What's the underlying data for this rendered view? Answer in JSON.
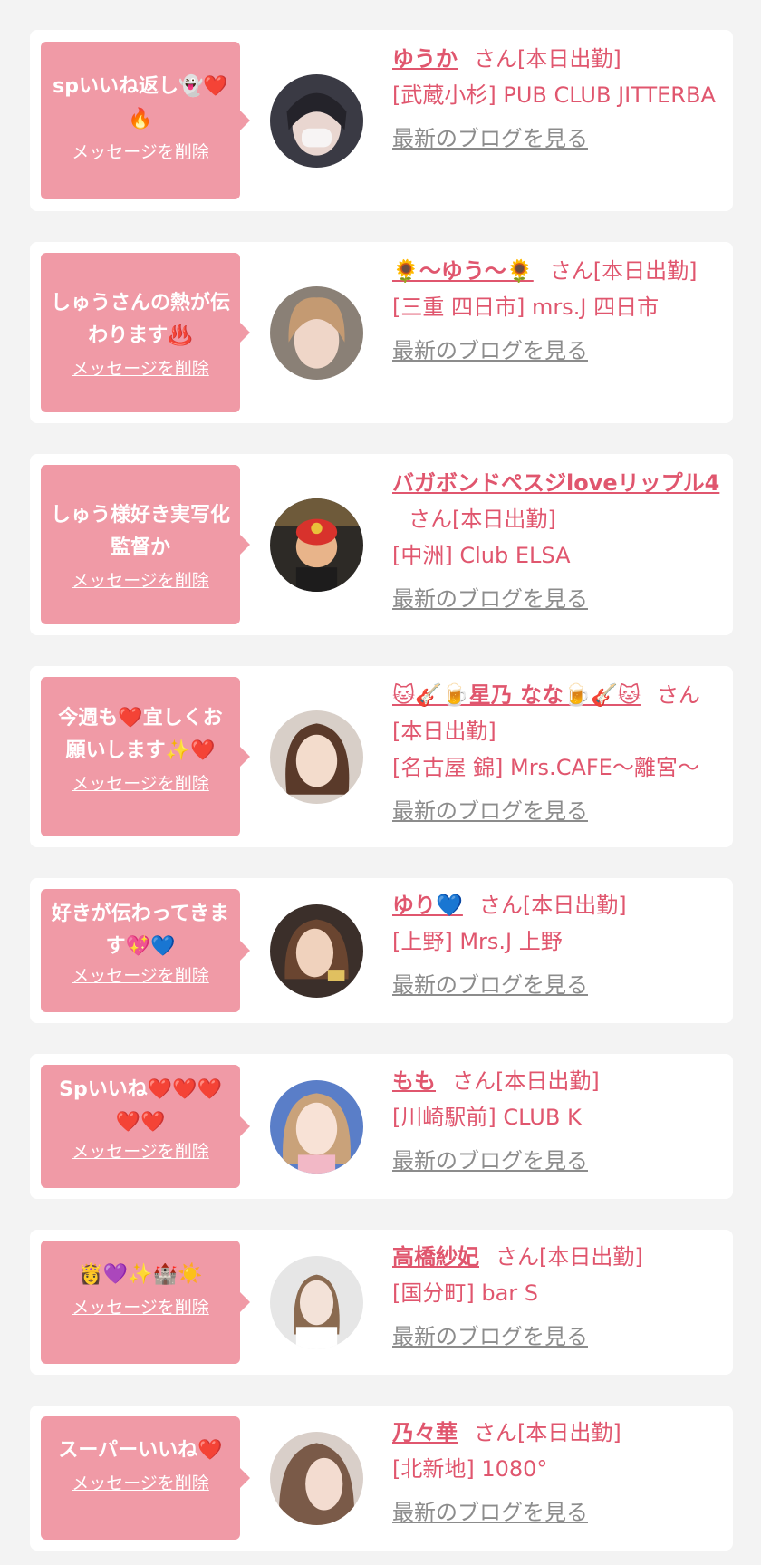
{
  "common": {
    "delete_label": "メッセージを削除",
    "blog_label": "最新のブログを見る",
    "san_suffix": "さん[本日出勤]"
  },
  "colors": {
    "page_bg": "#f3f3f3",
    "bubble_bg": "#f09aa6",
    "accent_text": "#e0566e",
    "blog_link": "#8c8c8c"
  },
  "cards": [
    {
      "message": "spいいね返し👻❤️🔥",
      "name": "ゆうか",
      "location": "[武蔵小杉] PUB CLUB JITTERBA"
    },
    {
      "message": "しゅうさんの熱が伝わります♨️",
      "name": "🌻〜ゆう〜🌻",
      "location": "[三重 四日市] mrs.J 四日市"
    },
    {
      "message": "しゅう様好き実写化　監督か",
      "name": "バガボンドペスジloveリップル4",
      "location": "[中洲] Club ELSA"
    },
    {
      "message": "今週も❤️宜しくお願いします✨❤️",
      "name": "🐱🎸🍺星乃 なな🍺🎸🐱",
      "location": "[名古屋 錦] Mrs.CAFE〜離宮〜"
    },
    {
      "message": "好きが伝わってきます💖💙",
      "name": "ゆり💙",
      "location": "[上野] Mrs.J 上野"
    },
    {
      "message": "Spいいね❤️❤️❤️❤️❤️",
      "name": "もも",
      "location": "[川崎駅前] CLUB K"
    },
    {
      "message": "👸💜✨🏰☀️",
      "name": "高橋紗妃",
      "location": "[国分町] bar S"
    },
    {
      "message": "スーパーいいね❤️",
      "name": "乃々華",
      "location": "[北新地] 1080°"
    }
  ]
}
